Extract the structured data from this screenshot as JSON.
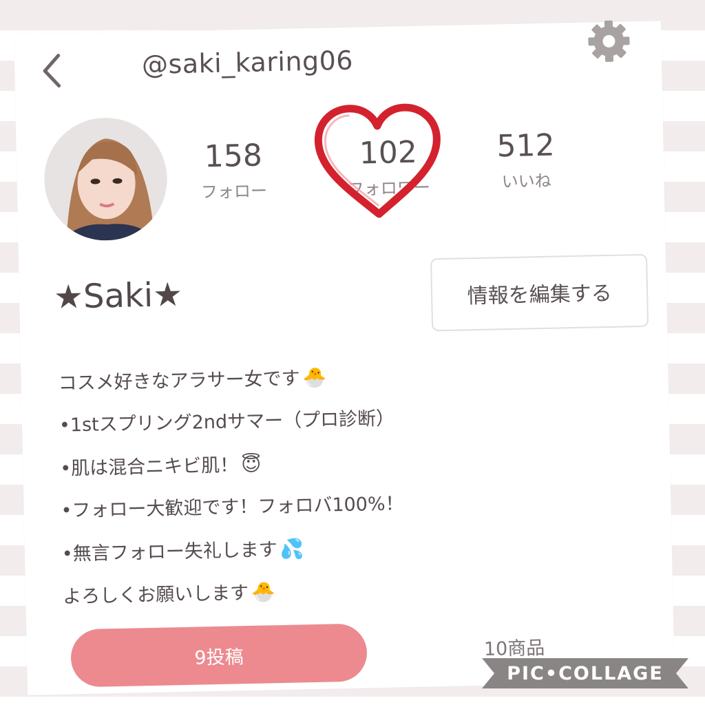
{
  "header": {
    "username": "@saki_karing06",
    "back_icon": "chevron-left-icon",
    "settings_icon": "gear-icon"
  },
  "stats": {
    "follow_count": "158",
    "follow_label": "フォロー",
    "follower_count": "102",
    "follower_label": "フォロワー",
    "likes_count": "512",
    "likes_label": "いいね"
  },
  "profile": {
    "display_name": "★Saki★",
    "edit_button": "情報を編集する",
    "bio": [
      "コスメ好きなアラサー女です",
      "•1stスプリング2ndサマー（プロ診断）",
      "•肌は混合ニキビ肌！",
      "•フォロー大歓迎です！フォロバ100%！",
      "•無言フォロー失礼します",
      "よろしくお願いします"
    ],
    "bio_emoji": [
      "🐣",
      "",
      "😇",
      "",
      "💦",
      "🐣"
    ]
  },
  "tabs": {
    "posts_label": "9投稿",
    "items_label": "10商品"
  },
  "watermark": "PIC•COLLAGE",
  "colors": {
    "accent_pink": "#ec8a90",
    "heart_red": "#d3222e",
    "text": "#595051"
  }
}
